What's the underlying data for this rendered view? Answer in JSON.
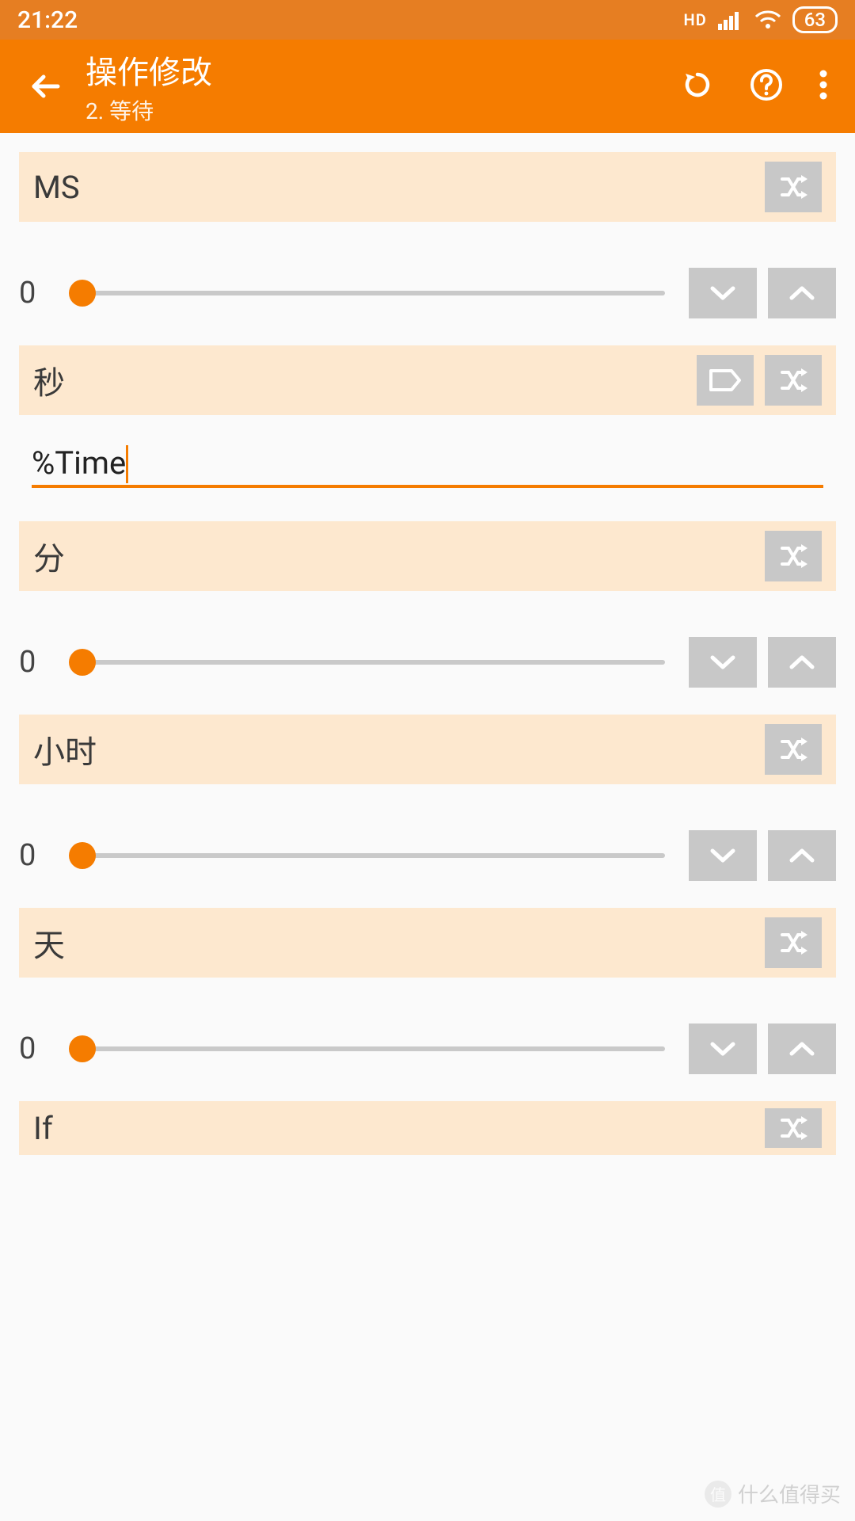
{
  "status": {
    "time": "21:22",
    "hd": "HD",
    "battery": "63"
  },
  "appbar": {
    "title": "操作修改",
    "subtitle": "2. 等待"
  },
  "sections": {
    "ms": {
      "label": "MS",
      "value": "0"
    },
    "seconds": {
      "label": "秒",
      "value": "%Time"
    },
    "minutes": {
      "label": "分",
      "value": "0"
    },
    "hours": {
      "label": "小时",
      "value": "0"
    },
    "days": {
      "label": "天",
      "value": "0"
    },
    "if": {
      "label": "If"
    }
  },
  "watermark": "什么值得买"
}
